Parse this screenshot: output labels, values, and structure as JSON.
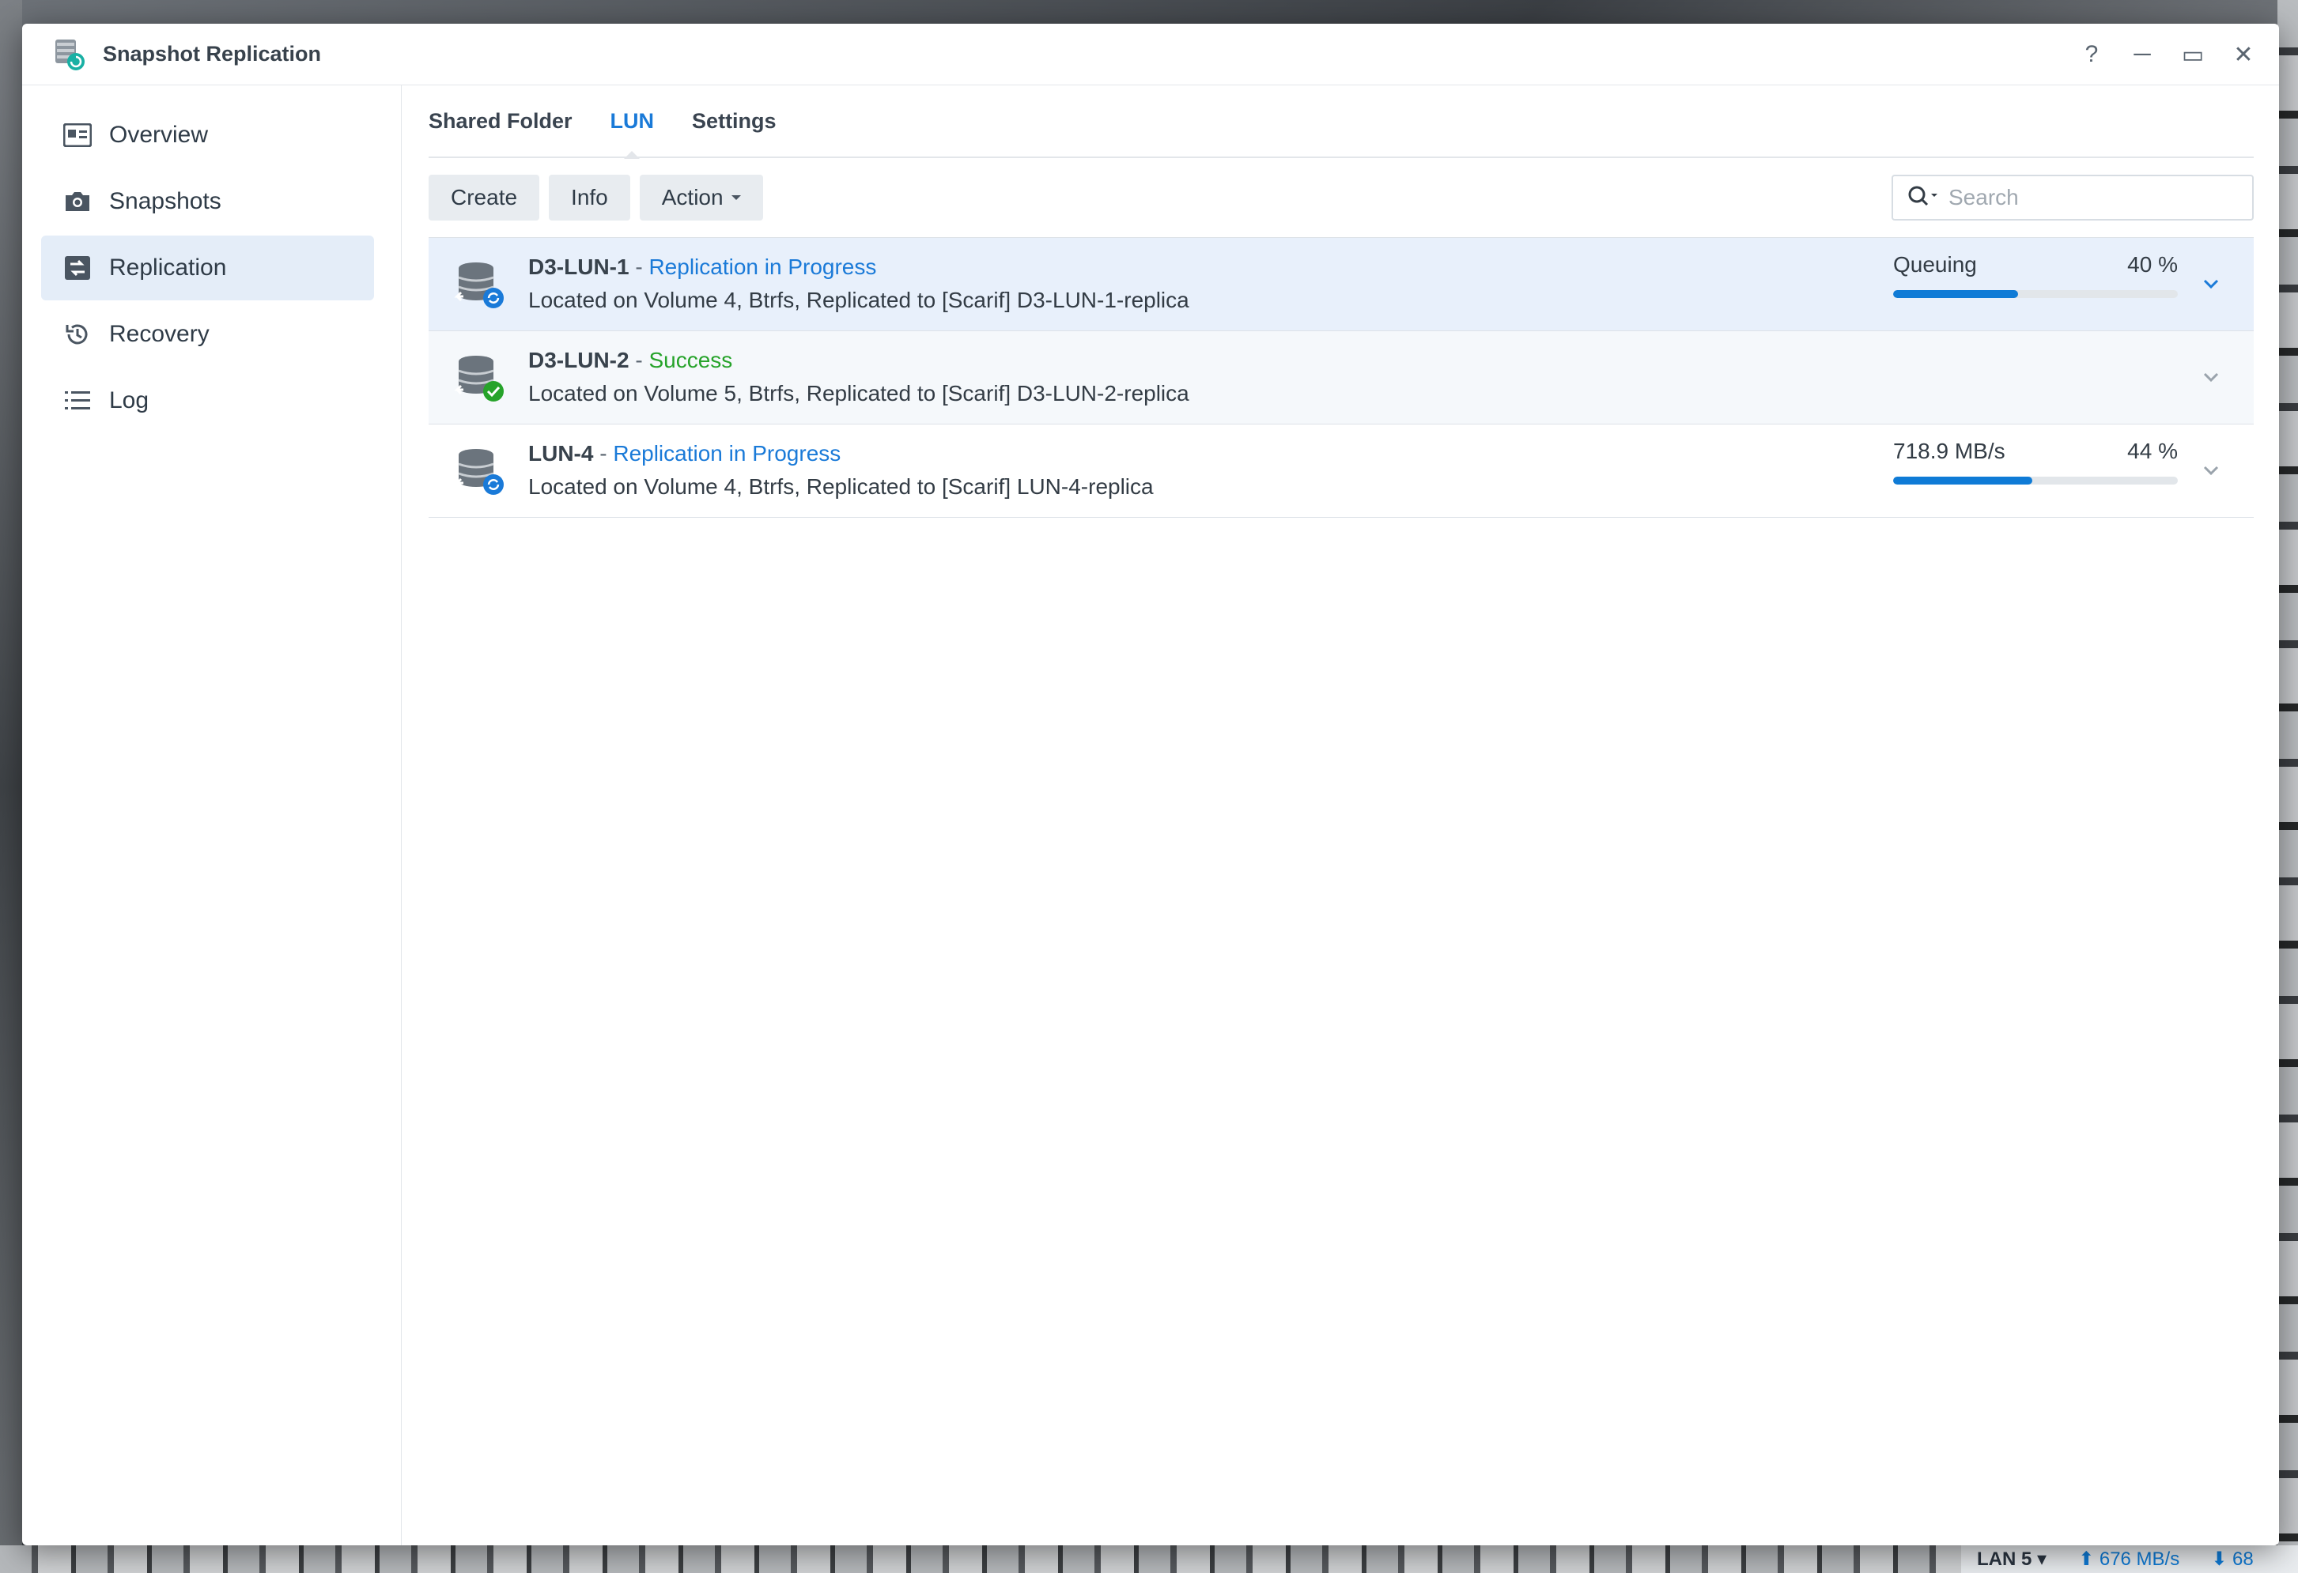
{
  "window": {
    "title": "Snapshot Replication",
    "controls": {
      "help": "?",
      "minimize": "─",
      "maximize": "▭",
      "close": "✕"
    }
  },
  "sidebar": {
    "items": [
      {
        "label": "Overview",
        "icon": "overview-card-icon",
        "active": false
      },
      {
        "label": "Snapshots",
        "icon": "camera-icon",
        "active": false
      },
      {
        "label": "Replication",
        "icon": "replication-icon",
        "active": true
      },
      {
        "label": "Recovery",
        "icon": "history-icon",
        "active": false
      },
      {
        "label": "Log",
        "icon": "list-icon",
        "active": false
      }
    ]
  },
  "tabs": [
    {
      "label": "Shared Folder",
      "active": false
    },
    {
      "label": "LUN",
      "active": true
    },
    {
      "label": "Settings",
      "active": false
    }
  ],
  "toolbar": {
    "create_label": "Create",
    "info_label": "Info",
    "action_label": "Action",
    "search_placeholder": "Search"
  },
  "rows": [
    {
      "name": "D3-LUN-1",
      "sep": " - ",
      "status": "Replication in Progress",
      "status_kind": "progress",
      "subtitle": "Located on Volume 4, Btrfs, Replicated to [Scarif] D3-LUN-1-replica",
      "progress_text": "Queuing",
      "progress_percent_label": "40 %",
      "progress_fraction": 0.44,
      "selected": true
    },
    {
      "name": "D3-LUN-2",
      "sep": " - ",
      "status": "Success",
      "status_kind": "success",
      "subtitle": "Located on Volume 5, Btrfs, Replicated to [Scarif] D3-LUN-2-replica",
      "selected": false
    },
    {
      "name": "LUN-4",
      "sep": " - ",
      "status": "Replication in Progress",
      "status_kind": "progress",
      "subtitle": "Located on Volume 4, Btrfs, Replicated to [Scarif] LUN-4-replica",
      "progress_text": "718.9 MB/s",
      "progress_percent_label": "44 %",
      "progress_fraction": 0.49,
      "selected": false
    }
  ],
  "taskbar": {
    "lan_label": "LAN 5",
    "upload_speed": "676 MB/s",
    "download_speed": "68"
  },
  "colors": {
    "accent": "#1a7ad8",
    "success": "#26a32a",
    "progress": "#0f7bd6",
    "selected_row": "#e8f0fb"
  }
}
